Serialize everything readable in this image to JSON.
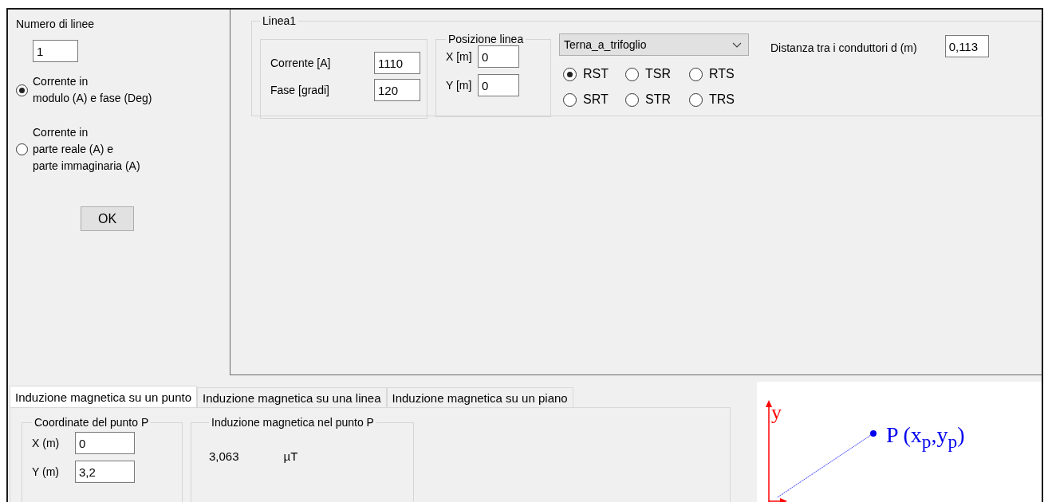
{
  "left_panel": {
    "lines_label": "Numero di linee",
    "lines_value": "1",
    "input_modes": [
      {
        "label": "Corrente in\nmodulo (A) e fase (Deg)",
        "selected": true
      },
      {
        "label": "Corrente in\nparte reale (A) e\nparte immaginaria (A)",
        "selected": false
      }
    ],
    "ok_button": "OK"
  },
  "line_group": {
    "title": "Linea1",
    "current": [
      {
        "label": "Corrente [A]",
        "value": "1110"
      },
      {
        "label": "Fase [gradi]",
        "value": "120"
      }
    ],
    "position": {
      "title": "Posizione linea",
      "fields": [
        {
          "label": "X [m]",
          "value": "0"
        },
        {
          "label": "Y [m]",
          "value": "0"
        }
      ]
    },
    "configuration": "Terna_a_trifoglio",
    "phase_orders": [
      {
        "label": "RST",
        "selected": true
      },
      {
        "label": "TSR",
        "selected": false
      },
      {
        "label": "RTS",
        "selected": false
      },
      {
        "label": "SRT",
        "selected": false
      },
      {
        "label": "STR",
        "selected": false
      },
      {
        "label": "TRS",
        "selected": false
      }
    ],
    "distance": {
      "label": "Distanza tra i conduttori d (m)",
      "value": "0,113"
    }
  },
  "tabs": [
    {
      "label": "Induzione magnetica su un punto",
      "selected": true
    },
    {
      "label": "Induzione magnetica su una linea",
      "selected": false
    },
    {
      "label": "Induzione magnetica su un piano",
      "selected": false
    }
  ],
  "point_tab": {
    "coordinates": {
      "title": "Coordinate del punto P",
      "fields": [
        {
          "label": "X (m)",
          "value": "0"
        },
        {
          "label": "Y (m)",
          "value": "3,2"
        }
      ]
    },
    "result": {
      "title": "Induzione magnetica nel punto P",
      "value": "3,063",
      "unit": "µT"
    }
  },
  "diagram": {
    "axis_label": "y",
    "point_label": "P (x$_{p}$,y$_{p}$)"
  }
}
